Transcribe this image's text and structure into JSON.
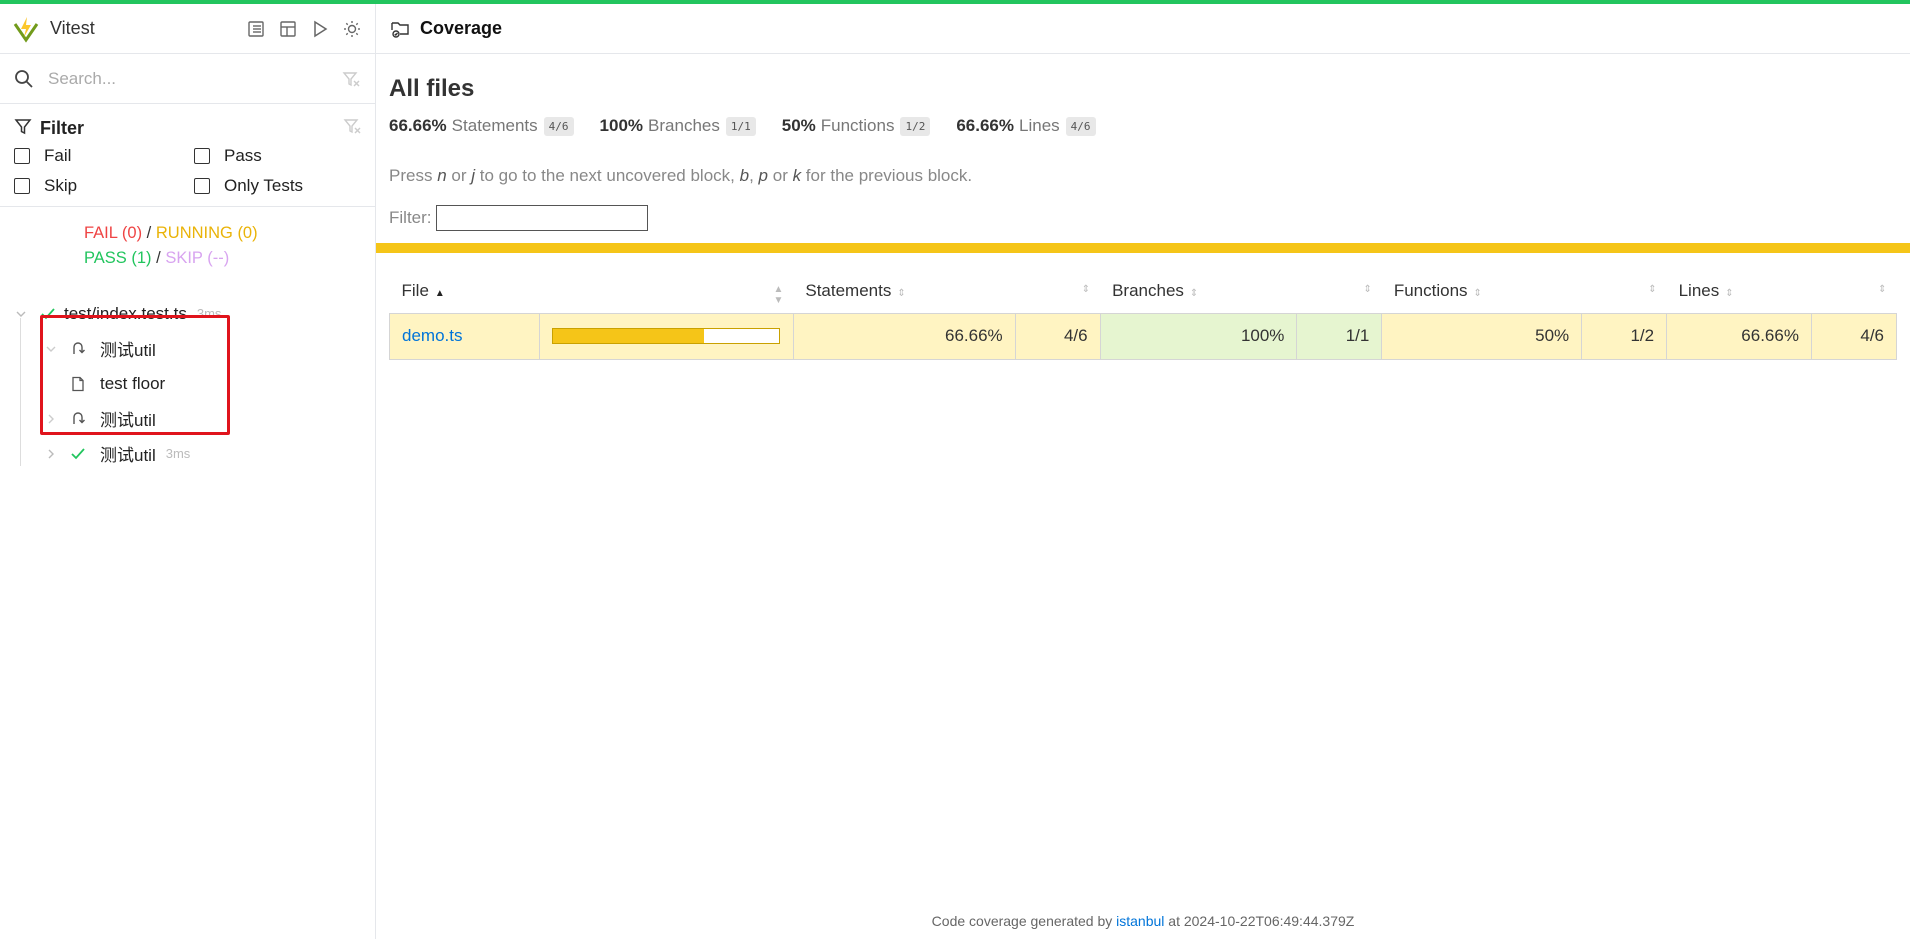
{
  "app": {
    "title": "Vitest"
  },
  "search": {
    "placeholder": "Search..."
  },
  "filter": {
    "label": "Filter",
    "options": [
      "Fail",
      "Pass",
      "Skip",
      "Only Tests"
    ]
  },
  "summary": {
    "fail": "FAIL (0)",
    "running": "RUNNING (0)",
    "pass": "PASS (1)",
    "skip": "SKIP (--)",
    "separator": "/"
  },
  "tree": {
    "file": {
      "name": "test/index.test.ts",
      "time": "3ms"
    },
    "items": [
      {
        "name": "测试util",
        "icon": "loop-icon"
      },
      {
        "name": "test floor",
        "icon": "file-icon"
      },
      {
        "name": "测试util",
        "icon": "loop-icon"
      },
      {
        "name": "测试util",
        "icon": "check-icon",
        "time": "3ms"
      }
    ]
  },
  "main": {
    "title": "Coverage"
  },
  "coverage": {
    "title": "All files",
    "stats": [
      {
        "pct": "66.66%",
        "name": "Statements",
        "frac": "4/6"
      },
      {
        "pct": "100%",
        "name": "Branches",
        "frac": "1/1"
      },
      {
        "pct": "50%",
        "name": "Functions",
        "frac": "1/2"
      },
      {
        "pct": "66.66%",
        "name": "Lines",
        "frac": "4/6"
      }
    ],
    "hint": {
      "p1": "Press ",
      "n": "n",
      "p2": " or ",
      "j": "j",
      "p3": " to go to the next uncovered block, ",
      "b": "b",
      "p4": ", ",
      "p": "p",
      "p5": " or ",
      "k": "k",
      "p6": " for the previous block."
    },
    "filter_label": "Filter:",
    "columns": [
      "File",
      "Statements",
      "Branches",
      "Functions",
      "Lines"
    ],
    "rows": [
      {
        "file": "demo.ts",
        "bar_fraction": 0.6666,
        "statements": "66.66%",
        "statements_frac": "4/6",
        "branches": "100%",
        "branches_frac": "1/1",
        "functions": "50%",
        "functions_frac": "1/2",
        "lines": "66.66%",
        "lines_frac": "4/6"
      }
    ],
    "footer": {
      "prefix": "Code coverage generated by ",
      "tool": "istanbul",
      "suffix": " at 2024-10-22T06:49:44.379Z"
    }
  },
  "colors": {
    "accent_green": "#22c55e",
    "medium_coverage": "#fff4c2",
    "high_coverage": "#e6f5d0",
    "bar_yellow": "#f5c518",
    "highlight_box": "#e0141c"
  }
}
